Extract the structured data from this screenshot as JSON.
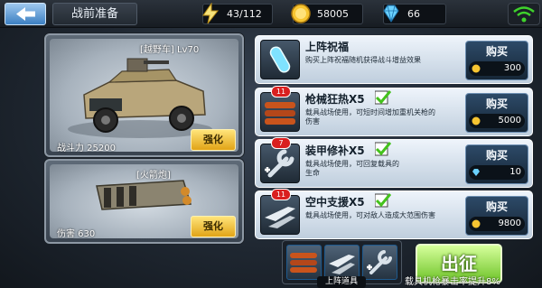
{
  "header": {
    "title": "战前准备",
    "energy": "43/112",
    "gold": "58005",
    "gems": "66"
  },
  "vehicle_card": {
    "tag": "[越野车] Lv70",
    "stat": "战斗力 25200",
    "upgrade_label": "强化"
  },
  "weapon_card": {
    "tag": "[火箭炮]",
    "stat": "伤害 630",
    "upgrade_label": "强化"
  },
  "items": [
    {
      "name": "上阵祝福",
      "desc": "购买上阵祝福随机获得战斗增益效果",
      "buy_label": "购买",
      "price": "300",
      "currency": "gold"
    },
    {
      "name": "枪械狂热X5",
      "desc": "载具战场使用，可短时间增加重机关枪的伤害",
      "buy_label": "购买",
      "price": "5000",
      "currency": "gold",
      "badge": "11"
    },
    {
      "name": "装甲修补X5",
      "desc": "载具战场使用，可回复载具的生命",
      "buy_label": "购买",
      "price": "10",
      "currency": "gem",
      "badge": "7"
    },
    {
      "name": "空中支援X5",
      "desc": "载具战场使用，可对敌人造成大范围伤害",
      "buy_label": "购买",
      "price": "9800",
      "currency": "gold",
      "badge": "11"
    }
  ],
  "loadout": {
    "label": "上阵道具"
  },
  "launch": {
    "label": "出征",
    "note": "载具机枪暴击率提升8%"
  },
  "colors": {
    "gold_button": "#f0c040",
    "launch_green": "#8ed84a",
    "check_green": "#44c21c"
  }
}
